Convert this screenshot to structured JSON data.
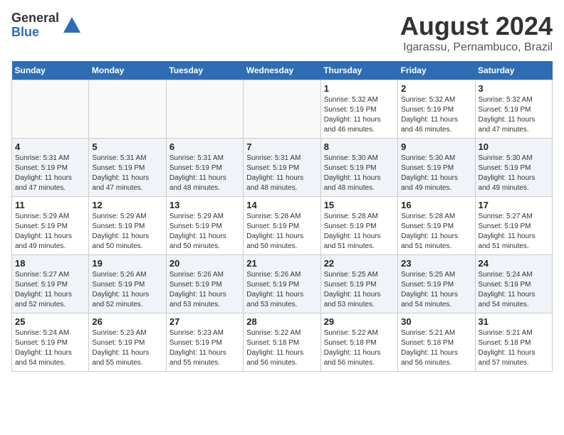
{
  "header": {
    "logo_general": "General",
    "logo_blue": "Blue",
    "month_year": "August 2024",
    "location": "Igarassu, Pernambuco, Brazil"
  },
  "days_of_week": [
    "Sunday",
    "Monday",
    "Tuesday",
    "Wednesday",
    "Thursday",
    "Friday",
    "Saturday"
  ],
  "weeks": [
    [
      {
        "day": "",
        "info": ""
      },
      {
        "day": "",
        "info": ""
      },
      {
        "day": "",
        "info": ""
      },
      {
        "day": "",
        "info": ""
      },
      {
        "day": "1",
        "info": "Sunrise: 5:32 AM\nSunset: 5:19 PM\nDaylight: 11 hours\nand 46 minutes."
      },
      {
        "day": "2",
        "info": "Sunrise: 5:32 AM\nSunset: 5:19 PM\nDaylight: 11 hours\nand 46 minutes."
      },
      {
        "day": "3",
        "info": "Sunrise: 5:32 AM\nSunset: 5:19 PM\nDaylight: 11 hours\nand 47 minutes."
      }
    ],
    [
      {
        "day": "4",
        "info": "Sunrise: 5:31 AM\nSunset: 5:19 PM\nDaylight: 11 hours\nand 47 minutes."
      },
      {
        "day": "5",
        "info": "Sunrise: 5:31 AM\nSunset: 5:19 PM\nDaylight: 11 hours\nand 47 minutes."
      },
      {
        "day": "6",
        "info": "Sunrise: 5:31 AM\nSunset: 5:19 PM\nDaylight: 11 hours\nand 48 minutes."
      },
      {
        "day": "7",
        "info": "Sunrise: 5:31 AM\nSunset: 5:19 PM\nDaylight: 11 hours\nand 48 minutes."
      },
      {
        "day": "8",
        "info": "Sunrise: 5:30 AM\nSunset: 5:19 PM\nDaylight: 11 hours\nand 48 minutes."
      },
      {
        "day": "9",
        "info": "Sunrise: 5:30 AM\nSunset: 5:19 PM\nDaylight: 11 hours\nand 49 minutes."
      },
      {
        "day": "10",
        "info": "Sunrise: 5:30 AM\nSunset: 5:19 PM\nDaylight: 11 hours\nand 49 minutes."
      }
    ],
    [
      {
        "day": "11",
        "info": "Sunrise: 5:29 AM\nSunset: 5:19 PM\nDaylight: 11 hours\nand 49 minutes."
      },
      {
        "day": "12",
        "info": "Sunrise: 5:29 AM\nSunset: 5:19 PM\nDaylight: 11 hours\nand 50 minutes."
      },
      {
        "day": "13",
        "info": "Sunrise: 5:29 AM\nSunset: 5:19 PM\nDaylight: 11 hours\nand 50 minutes."
      },
      {
        "day": "14",
        "info": "Sunrise: 5:28 AM\nSunset: 5:19 PM\nDaylight: 11 hours\nand 50 minutes."
      },
      {
        "day": "15",
        "info": "Sunrise: 5:28 AM\nSunset: 5:19 PM\nDaylight: 11 hours\nand 51 minutes."
      },
      {
        "day": "16",
        "info": "Sunrise: 5:28 AM\nSunset: 5:19 PM\nDaylight: 11 hours\nand 51 minutes."
      },
      {
        "day": "17",
        "info": "Sunrise: 5:27 AM\nSunset: 5:19 PM\nDaylight: 11 hours\nand 51 minutes."
      }
    ],
    [
      {
        "day": "18",
        "info": "Sunrise: 5:27 AM\nSunset: 5:19 PM\nDaylight: 11 hours\nand 52 minutes."
      },
      {
        "day": "19",
        "info": "Sunrise: 5:26 AM\nSunset: 5:19 PM\nDaylight: 11 hours\nand 52 minutes."
      },
      {
        "day": "20",
        "info": "Sunrise: 5:26 AM\nSunset: 5:19 PM\nDaylight: 11 hours\nand 53 minutes."
      },
      {
        "day": "21",
        "info": "Sunrise: 5:26 AM\nSunset: 5:19 PM\nDaylight: 11 hours\nand 53 minutes."
      },
      {
        "day": "22",
        "info": "Sunrise: 5:25 AM\nSunset: 5:19 PM\nDaylight: 11 hours\nand 53 minutes."
      },
      {
        "day": "23",
        "info": "Sunrise: 5:25 AM\nSunset: 5:19 PM\nDaylight: 11 hours\nand 54 minutes."
      },
      {
        "day": "24",
        "info": "Sunrise: 5:24 AM\nSunset: 5:19 PM\nDaylight: 11 hours\nand 54 minutes."
      }
    ],
    [
      {
        "day": "25",
        "info": "Sunrise: 5:24 AM\nSunset: 5:19 PM\nDaylight: 11 hours\nand 54 minutes."
      },
      {
        "day": "26",
        "info": "Sunrise: 5:23 AM\nSunset: 5:19 PM\nDaylight: 11 hours\nand 55 minutes."
      },
      {
        "day": "27",
        "info": "Sunrise: 5:23 AM\nSunset: 5:19 PM\nDaylight: 11 hours\nand 55 minutes."
      },
      {
        "day": "28",
        "info": "Sunrise: 5:22 AM\nSunset: 5:18 PM\nDaylight: 11 hours\nand 56 minutes."
      },
      {
        "day": "29",
        "info": "Sunrise: 5:22 AM\nSunset: 5:18 PM\nDaylight: 11 hours\nand 56 minutes."
      },
      {
        "day": "30",
        "info": "Sunrise: 5:21 AM\nSunset: 5:18 PM\nDaylight: 11 hours\nand 56 minutes."
      },
      {
        "day": "31",
        "info": "Sunrise: 5:21 AM\nSunset: 5:18 PM\nDaylight: 11 hours\nand 57 minutes."
      }
    ]
  ]
}
